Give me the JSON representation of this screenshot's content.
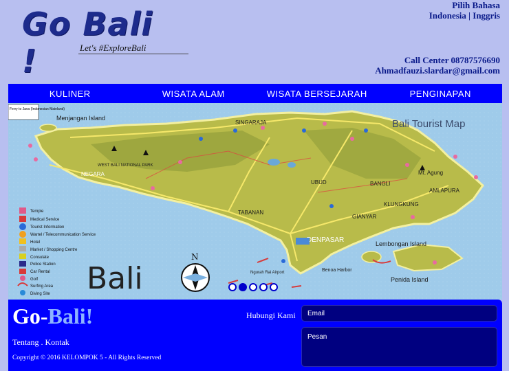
{
  "header": {
    "logo_title": "Go Bali !",
    "logo_tagline": "Let's #ExploreBali",
    "lang_title": "Pilih Bahasa",
    "lang_options": "Indonesia | Inggris",
    "call_center": "Call Center 08787576690",
    "email": "Ahmadfauzi.slardar@gmail.com"
  },
  "nav": {
    "items": [
      "KULINER",
      "WISATA ALAM",
      "WISATA BERSEJARAH",
      "PENGINAPAN"
    ]
  },
  "map": {
    "title": "Bali Tourist Map",
    "big_label": "Bali",
    "ferry": "Ferry to Java (Indonesian Mainland)",
    "places": {
      "menjangan": "Menjangan Island",
      "singaraja": "SINGARAJA",
      "negara": "NEGARA",
      "np": "WEST BALI NATIONAL PARK",
      "denpasar": "DENPASAR",
      "tabanan": "TABANAN",
      "gianyar": "GIANYAR",
      "bangli": "BANGLI",
      "klungkung": "KLUNGKUNG",
      "amlapura": "AMLAPURA",
      "agung": "Mt. Agung",
      "lembongan": "Lembongan Island",
      "penida": "Penida Island",
      "benoa": "Benoa Harbor",
      "airport": "Ngurah Rai Airport",
      "ubud": "UBUD"
    },
    "legend": [
      "Temple",
      "Medical Service",
      "Tourist Information",
      "Wartel / Telecommunication Service",
      "Hotel",
      "Market / Shopping Centre",
      "Consulate",
      "Police Station",
      "Car Rental",
      "Golf",
      "Surfing Area",
      "Diving Site"
    ],
    "slide_count": 5,
    "active_slide": 1
  },
  "footer": {
    "brand_a": "Go-",
    "brand_b": "Bali!",
    "links": "Tentang . Kontak",
    "copyright": "Copyright © 2016 KELOMPOK 5 - All Rights Reserved",
    "contact_label": "Hubungi Kami",
    "email_placeholder": "Email",
    "message_placeholder": "Pesan"
  },
  "colors": {
    "background": "#b8bff0",
    "nav": "#0000ff",
    "footer": "#0000ff",
    "field": "#000080",
    "logo": "#1d2b8c"
  }
}
